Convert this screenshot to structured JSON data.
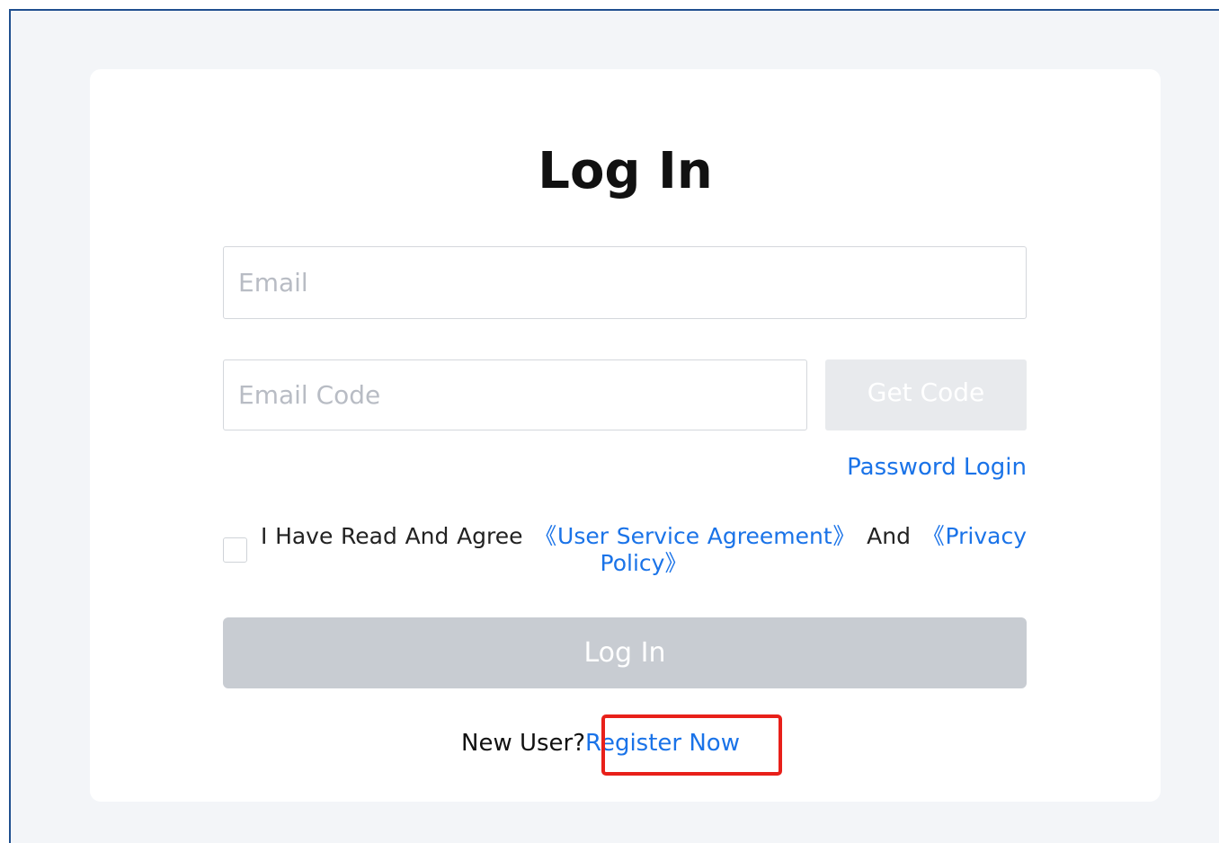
{
  "page": {
    "title": "Log In"
  },
  "form": {
    "email_placeholder": "Email",
    "email_value": "",
    "code_placeholder": "Email Code",
    "code_value": "",
    "get_code_label": "Get Code",
    "password_login_label": "Password Login",
    "agreement": {
      "checked": false,
      "prefix": "I Have Read And Agree",
      "user_agreement_link": "《User Service Agreement》",
      "conjunction": "And",
      "privacy_link": "《Privacy Policy》"
    },
    "login_button_label": "Log In"
  },
  "footer": {
    "new_user_text": "New User?",
    "register_link": "Register Now"
  },
  "colors": {
    "link": "#1a73e8",
    "disabled_button": "#c8ccd2",
    "highlight": "#e8201a",
    "background": "#f3f5f8"
  }
}
